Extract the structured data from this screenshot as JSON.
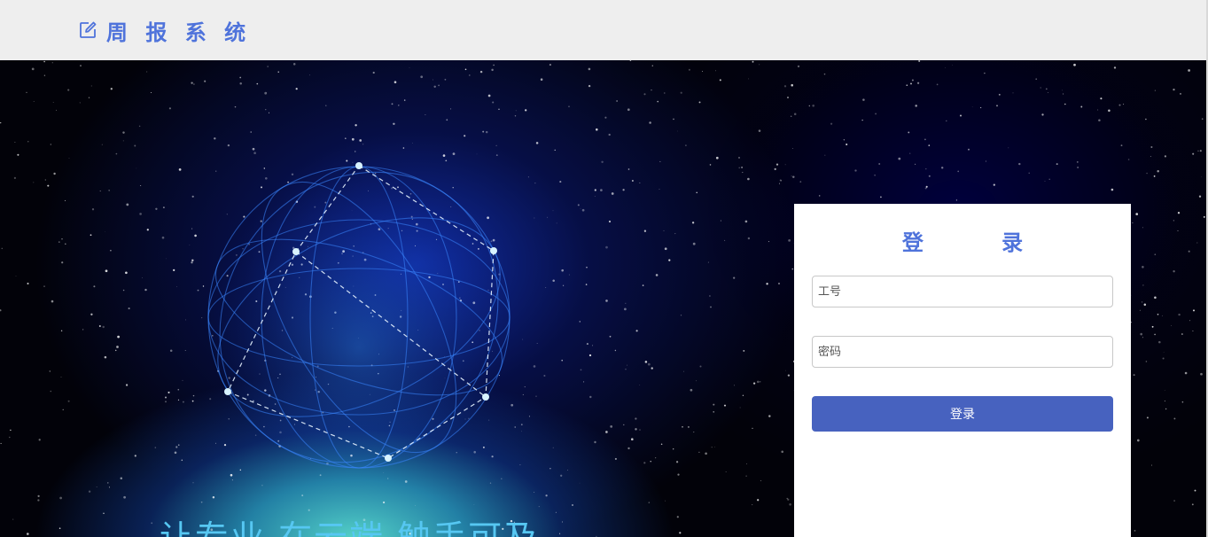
{
  "header": {
    "icon": "edit-icon",
    "title": "周 报 系 统",
    "accent_color": "#4f73db"
  },
  "hero": {
    "slogan": "让专业 在云端 触手可及",
    "globe_icon": "network-globe-graphic"
  },
  "login": {
    "title": "登 录",
    "id_placeholder": "工号",
    "password_placeholder": "密码",
    "submit_label": "登录",
    "button_color": "#4762bf"
  }
}
